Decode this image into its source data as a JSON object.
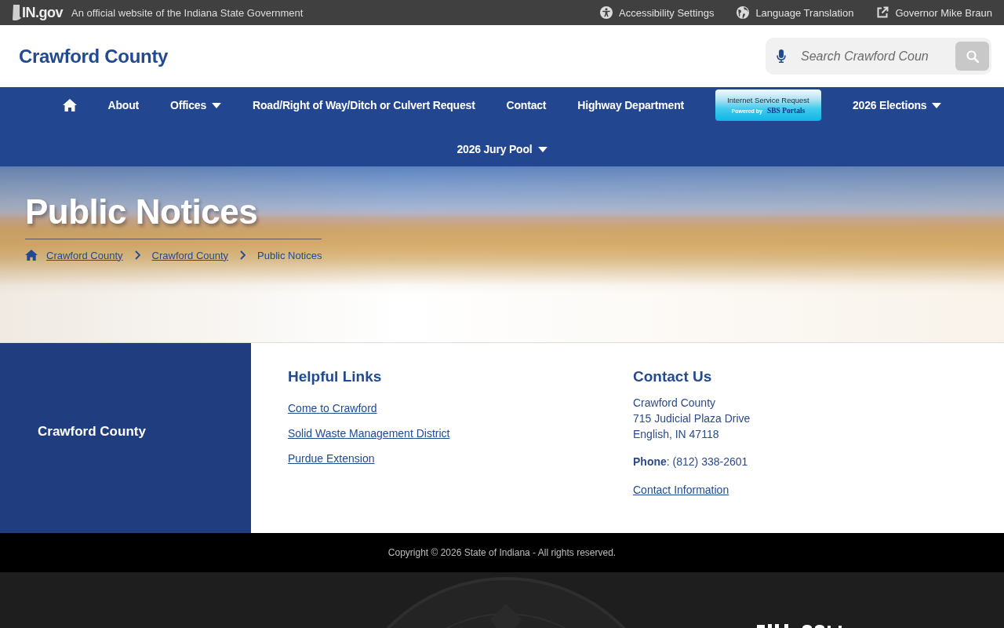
{
  "top_bar": {
    "logo": "IN.gov",
    "tagline": "An official website of the Indiana State Government",
    "links": [
      "Accessibility Settings",
      "Language Translation",
      "Governor Mike Braun"
    ]
  },
  "header": {
    "title": "Crawford County",
    "search": {
      "placeholder": "Search Crawford Coun"
    }
  },
  "nav": {
    "items": [
      {
        "kind": "home"
      },
      {
        "kind": "link",
        "label": "About"
      },
      {
        "kind": "dropdown",
        "label": "Offices"
      },
      {
        "kind": "link",
        "label": "Road/Right of Way/Ditch or Culvert Request"
      },
      {
        "kind": "link",
        "label": "Contact"
      },
      {
        "kind": "link",
        "label": "Highway Department"
      },
      {
        "kind": "banner",
        "label": "Internet Service Request",
        "caption": "Powered by",
        "brand": "SBS Portals"
      },
      {
        "kind": "dropdown",
        "label": "2026 Elections"
      },
      {
        "kind": "dropdown",
        "label": "2026 Jury Pool"
      }
    ]
  },
  "hero": {
    "title": "Public Notices",
    "breadcrumb": [
      {
        "kind": "home"
      },
      {
        "kind": "link",
        "label": "Crawford County"
      },
      {
        "kind": "link",
        "label": "Crawford County"
      },
      {
        "kind": "current",
        "label": "Public Notices"
      }
    ]
  },
  "footer": {
    "panel_title": "Crawford County",
    "helpful_links": {
      "heading": "Helpful Links",
      "links": [
        "Come to Crawford",
        "Solid Waste Management District",
        "Purdue Extension"
      ]
    },
    "contact": {
      "heading": "Contact Us",
      "address": [
        "Crawford County",
        "715 Judicial Plaza Drive",
        "English, IN 47118"
      ],
      "phone": "**Phone**: (812) 338-2601",
      "link": "Contact Information"
    }
  },
  "copyright": "Copyright © 2026 State of Indiana - All rights reserved."
}
